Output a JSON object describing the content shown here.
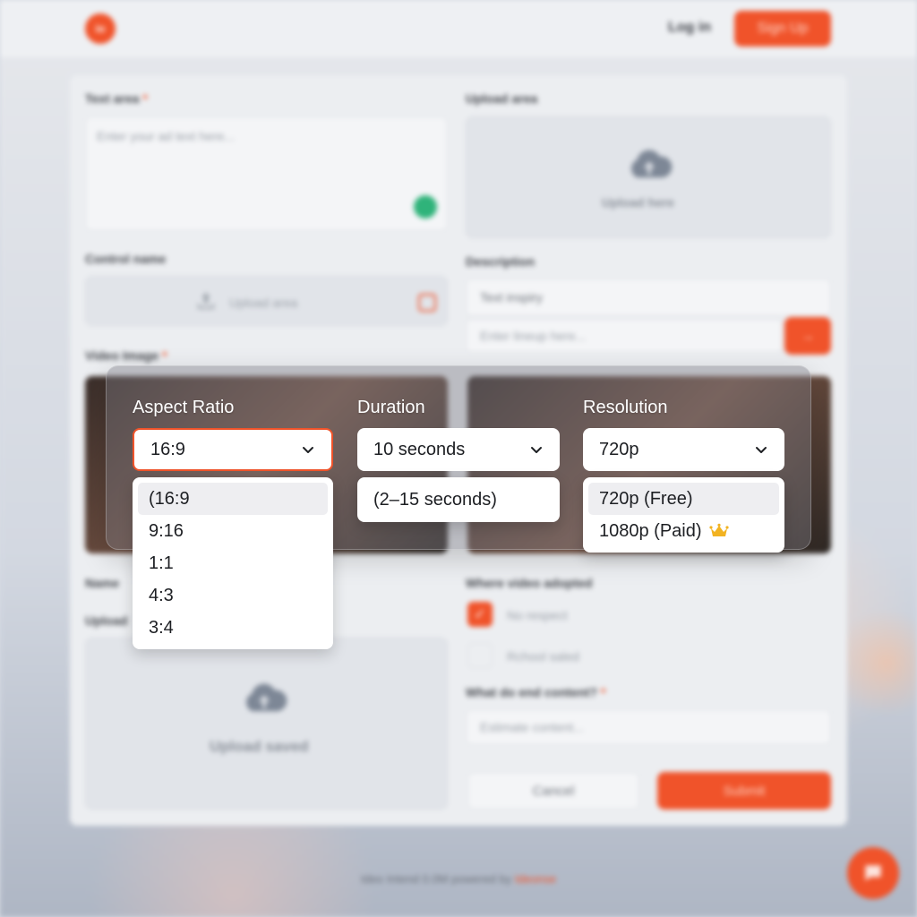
{
  "header": {
    "logo_text": "io",
    "login_label": "Log in",
    "signup_label": "Sign Up"
  },
  "form": {
    "text_area_label": "Text area",
    "text_area_placeholder": "Enter your ad text here...",
    "upload_area_label": "Upload area",
    "upload_here_label": "Upload here",
    "control_name_label": "Control name",
    "control_upload_label": "Upload area",
    "description_label": "Description",
    "description_select_value": "Text inspiry",
    "description_input_placeholder": "Enter lineup here...",
    "video_image_label": "Video Image",
    "name_label": "Name",
    "upload_label": "Upload",
    "upload_saved_label": "Upload saved",
    "where_video_label": "Where video adopted",
    "option_no_respect": "No respect",
    "option_school_saled": "Rchool saled",
    "what_content_label": "What do end content?",
    "estimate_placeholder": "Estimate content...",
    "cancel_label": "Cancel",
    "submit_label": "Submit",
    "required_mark": "*"
  },
  "footer": {
    "text": "Ideo Intend 0.0M powered by",
    "brand": "Ideonse"
  },
  "panel": {
    "aspect_ratio": {
      "title": "Aspect Ratio",
      "selected": "16:9",
      "options": [
        "(16:9",
        "9:16",
        "1:1",
        "4:3",
        "3:4"
      ]
    },
    "duration": {
      "title": "Duration",
      "selected": "10 seconds",
      "options": [
        "(2–15 seconds)"
      ]
    },
    "resolution": {
      "title": "Resolution",
      "selected": "720p",
      "options": [
        "720p (Free)",
        "1080p (Paid)"
      ]
    }
  },
  "colors": {
    "accent": "#f0532a",
    "crown": "#f2b321",
    "status_green": "#2fb37a"
  }
}
